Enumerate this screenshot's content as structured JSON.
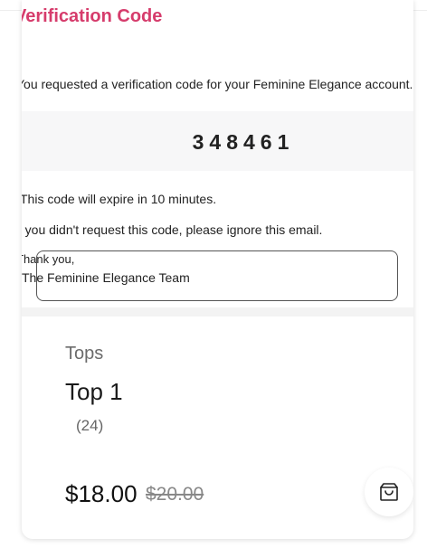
{
  "email": {
    "heading": "Verification Code",
    "intro": "You requested a verification code for your Feminine Elegance account.",
    "code": "348461",
    "expiry": "This code will expire in 10 minutes.",
    "ignore_note": "If you didn't request this code, please ignore this email.",
    "signoff": "Thank you,",
    "team": "The Feminine Elegance Team"
  },
  "product": {
    "category": "Tops",
    "name": "Top 1",
    "reviews": "(24)",
    "price": "$18.00",
    "original_price": "$20.00",
    "cart_icon": "shopping-bag-icon"
  }
}
